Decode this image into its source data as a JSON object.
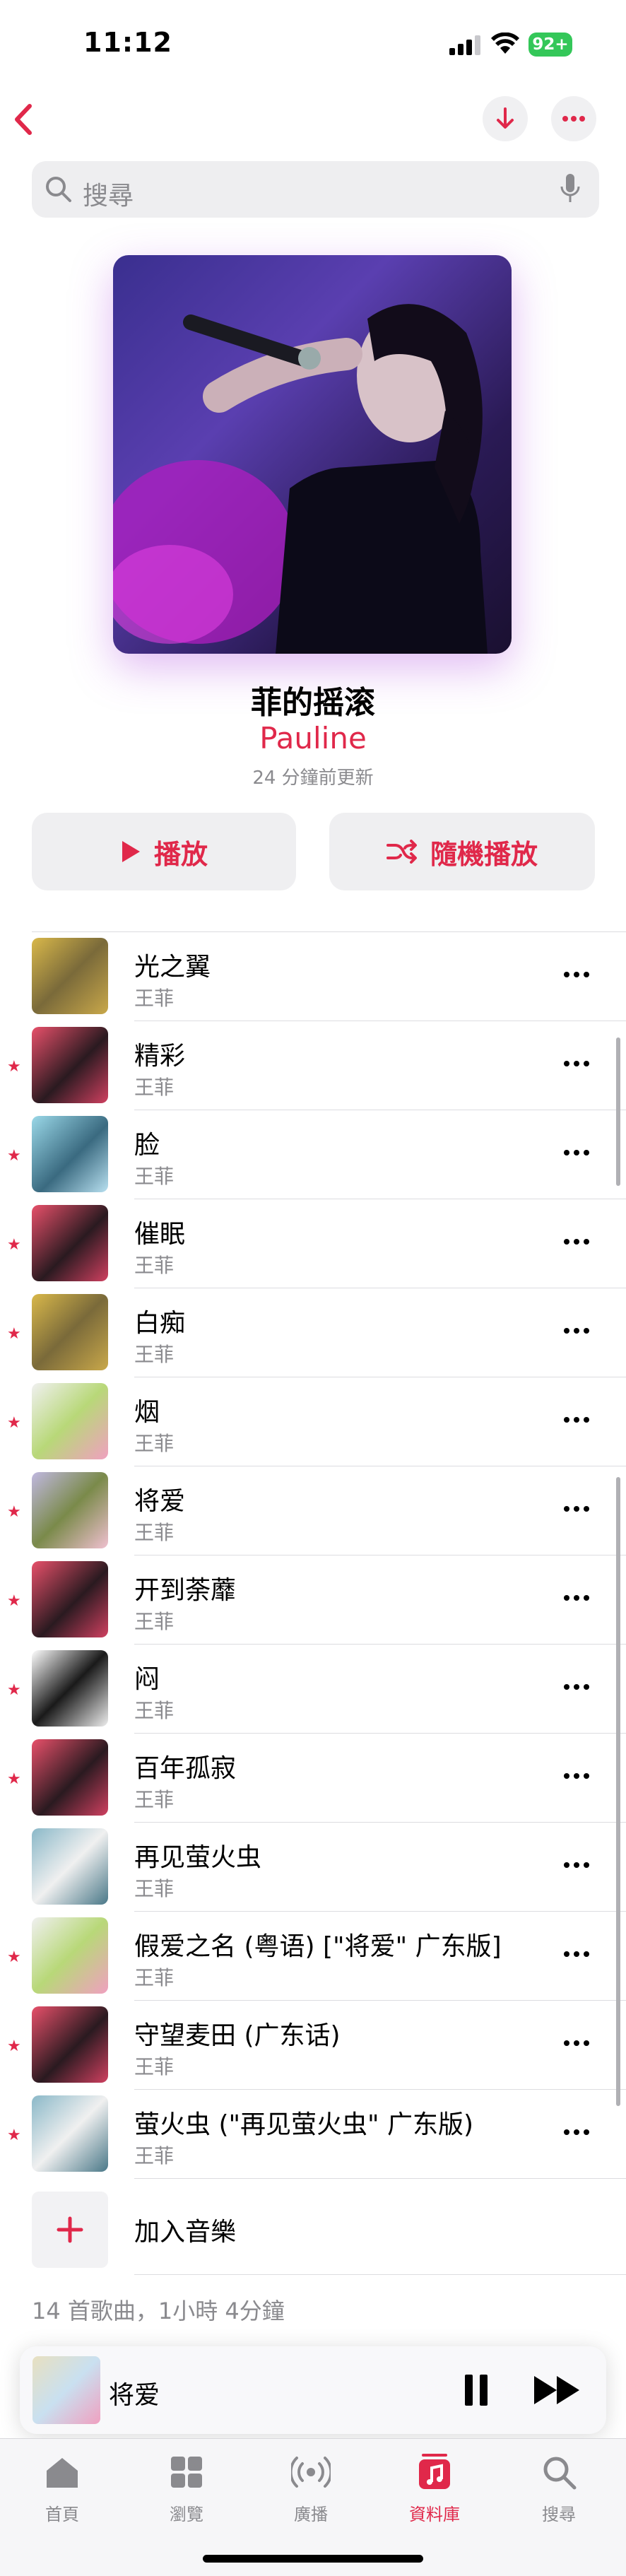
{
  "status_bar": {
    "time": "11:12",
    "battery": "92+"
  },
  "search": {
    "placeholder": "搜尋"
  },
  "playlist": {
    "title": "菲的摇滚",
    "artist": "Pauline",
    "updated": "24 分鐘前更新",
    "play_label": "播放",
    "shuffle_label": "隨機播放"
  },
  "songs": [
    {
      "title": "光之翼",
      "artist": "王菲",
      "favorite": false
    },
    {
      "title": "精彩",
      "artist": "王菲",
      "favorite": true
    },
    {
      "title": "脸",
      "artist": "王菲",
      "favorite": true
    },
    {
      "title": "催眠",
      "artist": "王菲",
      "favorite": true
    },
    {
      "title": "白痴",
      "artist": "王菲",
      "favorite": true
    },
    {
      "title": "烟",
      "artist": "王菲",
      "favorite": true
    },
    {
      "title": "将爱",
      "artist": "王菲",
      "favorite": true
    },
    {
      "title": "开到荼蘼",
      "artist": "王菲",
      "favorite": true
    },
    {
      "title": "闷",
      "artist": "王菲",
      "favorite": true
    },
    {
      "title": "百年孤寂",
      "artist": "王菲",
      "favorite": true
    },
    {
      "title": "再见萤火虫",
      "artist": "王菲",
      "favorite": false
    },
    {
      "title": "假爱之名 (粤语) [\"将爱\" 广东版]",
      "artist": "王菲",
      "favorite": true
    },
    {
      "title": "守望麦田 (广东话)",
      "artist": "王菲",
      "favorite": true
    },
    {
      "title": "萤火虫 (\"再见萤火虫\" 广东版)",
      "artist": "王菲",
      "favorite": true
    }
  ],
  "add_music_label": "加入音樂",
  "summary": "14 首歌曲，1小時 4分鐘",
  "now_playing": {
    "title": "将爱"
  },
  "tabs": [
    {
      "label": "首頁",
      "icon": "home-icon"
    },
    {
      "label": "瀏覽",
      "icon": "browse-icon"
    },
    {
      "label": "廣播",
      "icon": "radio-icon"
    },
    {
      "label": "資料庫",
      "icon": "library-icon",
      "active": true
    },
    {
      "label": "搜尋",
      "icon": "search-icon"
    }
  ],
  "colors": {
    "accent": "#e0284a",
    "battery": "#34c759"
  }
}
